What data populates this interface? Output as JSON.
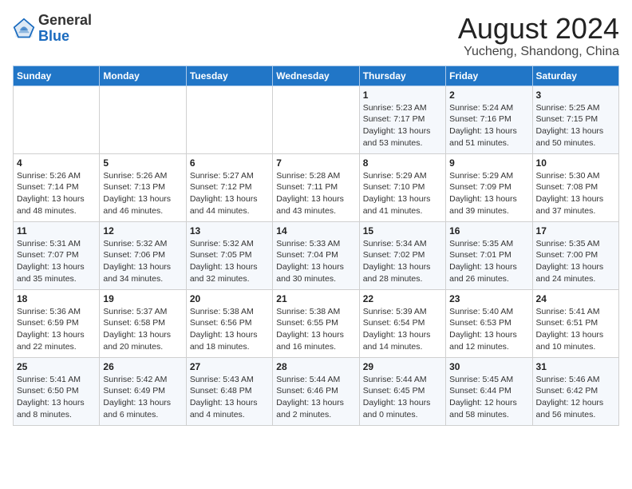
{
  "header": {
    "logo_line1": "General",
    "logo_line2": "Blue",
    "month_year": "August 2024",
    "location": "Yucheng, Shandong, China"
  },
  "weekdays": [
    "Sunday",
    "Monday",
    "Tuesday",
    "Wednesday",
    "Thursday",
    "Friday",
    "Saturday"
  ],
  "weeks": [
    [
      {
        "day": "",
        "info": ""
      },
      {
        "day": "",
        "info": ""
      },
      {
        "day": "",
        "info": ""
      },
      {
        "day": "",
        "info": ""
      },
      {
        "day": "1",
        "info": "Sunrise: 5:23 AM\nSunset: 7:17 PM\nDaylight: 13 hours\nand 53 minutes."
      },
      {
        "day": "2",
        "info": "Sunrise: 5:24 AM\nSunset: 7:16 PM\nDaylight: 13 hours\nand 51 minutes."
      },
      {
        "day": "3",
        "info": "Sunrise: 5:25 AM\nSunset: 7:15 PM\nDaylight: 13 hours\nand 50 minutes."
      }
    ],
    [
      {
        "day": "4",
        "info": "Sunrise: 5:26 AM\nSunset: 7:14 PM\nDaylight: 13 hours\nand 48 minutes."
      },
      {
        "day": "5",
        "info": "Sunrise: 5:26 AM\nSunset: 7:13 PM\nDaylight: 13 hours\nand 46 minutes."
      },
      {
        "day": "6",
        "info": "Sunrise: 5:27 AM\nSunset: 7:12 PM\nDaylight: 13 hours\nand 44 minutes."
      },
      {
        "day": "7",
        "info": "Sunrise: 5:28 AM\nSunset: 7:11 PM\nDaylight: 13 hours\nand 43 minutes."
      },
      {
        "day": "8",
        "info": "Sunrise: 5:29 AM\nSunset: 7:10 PM\nDaylight: 13 hours\nand 41 minutes."
      },
      {
        "day": "9",
        "info": "Sunrise: 5:29 AM\nSunset: 7:09 PM\nDaylight: 13 hours\nand 39 minutes."
      },
      {
        "day": "10",
        "info": "Sunrise: 5:30 AM\nSunset: 7:08 PM\nDaylight: 13 hours\nand 37 minutes."
      }
    ],
    [
      {
        "day": "11",
        "info": "Sunrise: 5:31 AM\nSunset: 7:07 PM\nDaylight: 13 hours\nand 35 minutes."
      },
      {
        "day": "12",
        "info": "Sunrise: 5:32 AM\nSunset: 7:06 PM\nDaylight: 13 hours\nand 34 minutes."
      },
      {
        "day": "13",
        "info": "Sunrise: 5:32 AM\nSunset: 7:05 PM\nDaylight: 13 hours\nand 32 minutes."
      },
      {
        "day": "14",
        "info": "Sunrise: 5:33 AM\nSunset: 7:04 PM\nDaylight: 13 hours\nand 30 minutes."
      },
      {
        "day": "15",
        "info": "Sunrise: 5:34 AM\nSunset: 7:02 PM\nDaylight: 13 hours\nand 28 minutes."
      },
      {
        "day": "16",
        "info": "Sunrise: 5:35 AM\nSunset: 7:01 PM\nDaylight: 13 hours\nand 26 minutes."
      },
      {
        "day": "17",
        "info": "Sunrise: 5:35 AM\nSunset: 7:00 PM\nDaylight: 13 hours\nand 24 minutes."
      }
    ],
    [
      {
        "day": "18",
        "info": "Sunrise: 5:36 AM\nSunset: 6:59 PM\nDaylight: 13 hours\nand 22 minutes."
      },
      {
        "day": "19",
        "info": "Sunrise: 5:37 AM\nSunset: 6:58 PM\nDaylight: 13 hours\nand 20 minutes."
      },
      {
        "day": "20",
        "info": "Sunrise: 5:38 AM\nSunset: 6:56 PM\nDaylight: 13 hours\nand 18 minutes."
      },
      {
        "day": "21",
        "info": "Sunrise: 5:38 AM\nSunset: 6:55 PM\nDaylight: 13 hours\nand 16 minutes."
      },
      {
        "day": "22",
        "info": "Sunrise: 5:39 AM\nSunset: 6:54 PM\nDaylight: 13 hours\nand 14 minutes."
      },
      {
        "day": "23",
        "info": "Sunrise: 5:40 AM\nSunset: 6:53 PM\nDaylight: 13 hours\nand 12 minutes."
      },
      {
        "day": "24",
        "info": "Sunrise: 5:41 AM\nSunset: 6:51 PM\nDaylight: 13 hours\nand 10 minutes."
      }
    ],
    [
      {
        "day": "25",
        "info": "Sunrise: 5:41 AM\nSunset: 6:50 PM\nDaylight: 13 hours\nand 8 minutes."
      },
      {
        "day": "26",
        "info": "Sunrise: 5:42 AM\nSunset: 6:49 PM\nDaylight: 13 hours\nand 6 minutes."
      },
      {
        "day": "27",
        "info": "Sunrise: 5:43 AM\nSunset: 6:48 PM\nDaylight: 13 hours\nand 4 minutes."
      },
      {
        "day": "28",
        "info": "Sunrise: 5:44 AM\nSunset: 6:46 PM\nDaylight: 13 hours\nand 2 minutes."
      },
      {
        "day": "29",
        "info": "Sunrise: 5:44 AM\nSunset: 6:45 PM\nDaylight: 13 hours\nand 0 minutes."
      },
      {
        "day": "30",
        "info": "Sunrise: 5:45 AM\nSunset: 6:44 PM\nDaylight: 12 hours\nand 58 minutes."
      },
      {
        "day": "31",
        "info": "Sunrise: 5:46 AM\nSunset: 6:42 PM\nDaylight: 12 hours\nand 56 minutes."
      }
    ]
  ]
}
